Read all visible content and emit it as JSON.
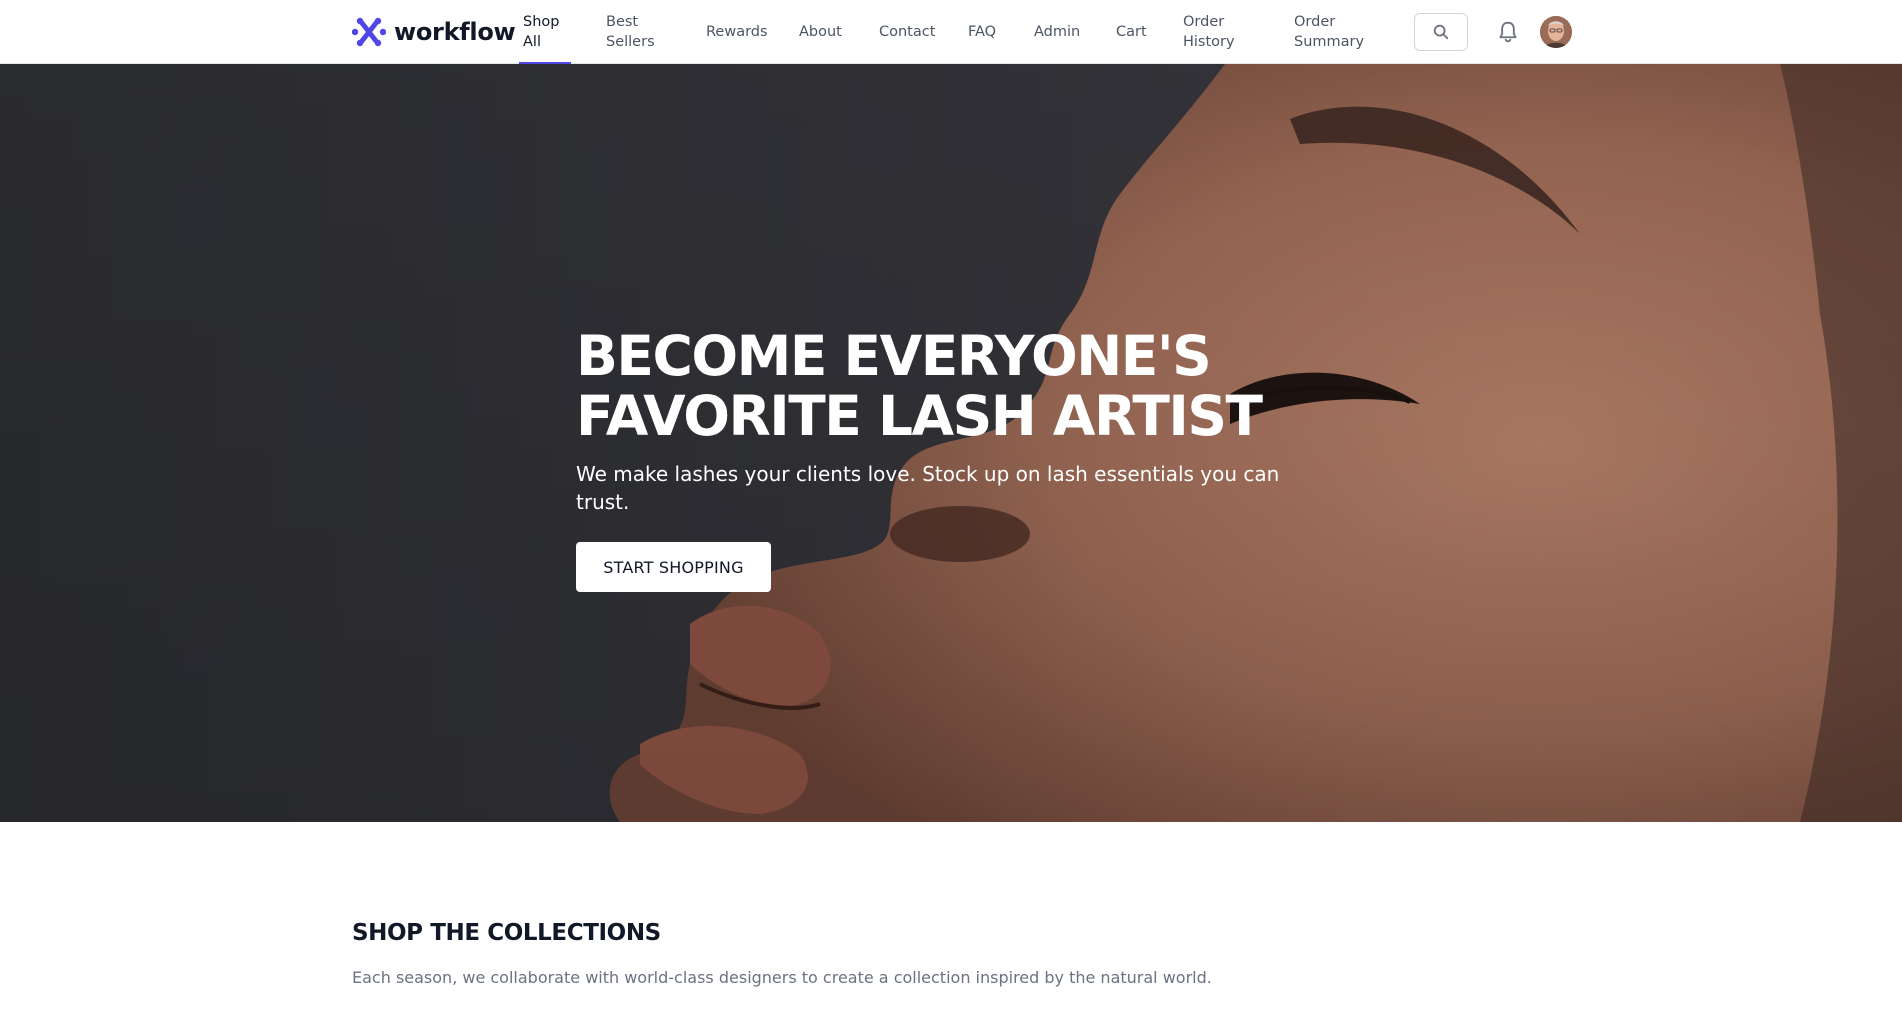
{
  "header": {
    "brand": "workflow",
    "nav": [
      {
        "label": "Shop All",
        "active": true
      },
      {
        "label": "Best Sellers",
        "active": false
      },
      {
        "label": "Rewards",
        "active": false
      },
      {
        "label": "About",
        "active": false
      },
      {
        "label": "Contact",
        "active": false
      },
      {
        "label": "FAQ",
        "active": false
      },
      {
        "label": "Admin",
        "active": false
      },
      {
        "label": "Cart",
        "active": false
      },
      {
        "label": "Order History",
        "active": false
      },
      {
        "label": "Order Summary",
        "active": false
      }
    ],
    "icons": {
      "search": "search-icon",
      "notifications": "bell-icon",
      "profile": "avatar"
    }
  },
  "hero": {
    "title_line1": "BECOME EVERYONE'S",
    "title_line2": "FAVORITE LASH ARTIST",
    "subtitle": "We make lashes your clients love. Stock up on lash essentials you can trust.",
    "cta": "START SHOPPING"
  },
  "collections": {
    "title": "SHOP THE COLLECTIONS",
    "description": "Each season, we collaborate with world-class designers to create a collection inspired by the natural world."
  },
  "colors": {
    "accent": "#4f46e5",
    "text": "#111827",
    "muted": "#6b7280",
    "hero_dark": "#2f3033"
  }
}
